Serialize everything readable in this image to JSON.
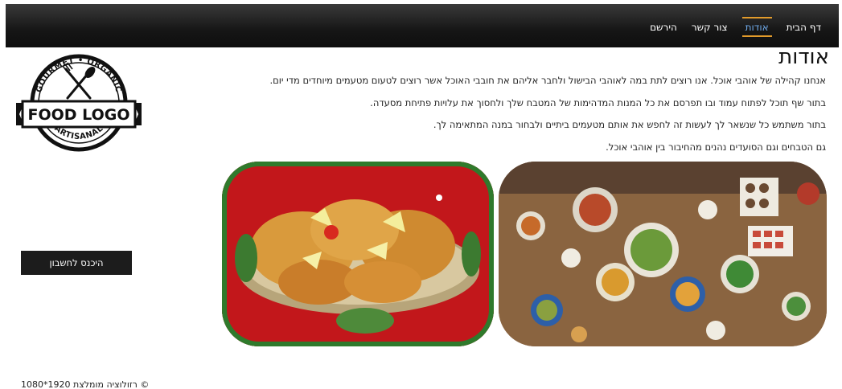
{
  "nav": {
    "items": [
      {
        "label": "דף הבית",
        "active": false
      },
      {
        "label": "אודות",
        "active": true
      },
      {
        "label": "צור קשר",
        "active": false
      },
      {
        "label": "הירשם",
        "active": false
      }
    ]
  },
  "logo": {
    "top_text": "GOURMET • ORGANIC",
    "main_text": "FOOD LOGO",
    "bottom_text": "ARTISANAL"
  },
  "main": {
    "title": "אודות",
    "paragraphs": [
      "אנחנו קהילה של אוהבי אוכל. אנו רוצים לתת במה לאוהבי הבישול ולחבר אליהם את חובבי האוכל אשר רוצים לטעום מטעמים מיוחדים מדי יום.",
      "בתור שף תוכל לפתוח עמוד ובו תפרסם את כל המנות המדהימות של המטבח שלך ולחסוך את עלויות פתיחת מסעדה.",
      "בתור משתמש כל שנשאר לך לעשות זה לחפש את אותם מטעמים ביתיים ולבחור במנה המתאימה לך.",
      "גם הטבחים וגם הסועדים נהנים מהחיבור בין אוהבי אוכל."
    ]
  },
  "login_button": {
    "label": "היכנס לחשבון"
  },
  "footer": {
    "text": "© רזולוציה מומלצת 1920*1080"
  },
  "colors": {
    "nav_active_text": "#6fa9e8",
    "nav_active_border": "#e29b2b",
    "navbar_bg": "#1a1a1a"
  }
}
